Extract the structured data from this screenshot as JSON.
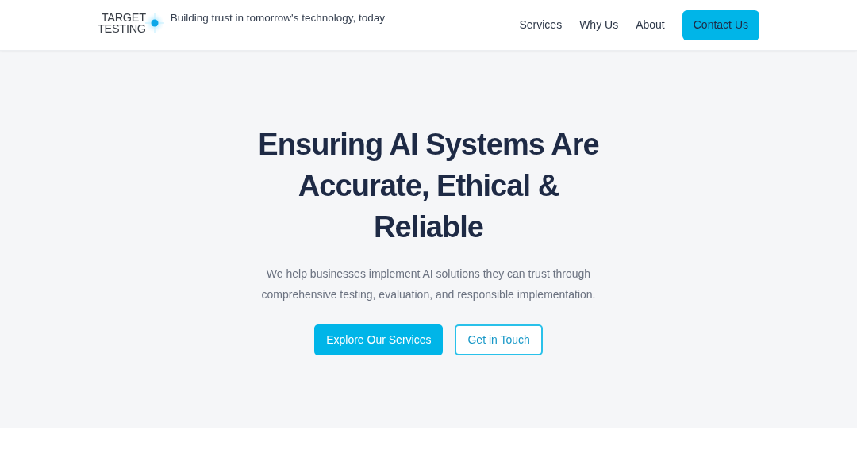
{
  "header": {
    "logo": {
      "line_1": "TARGET",
      "line_2": "TESTING"
    },
    "tagline": "Building trust in tomorrow's technology, today",
    "nav": [
      {
        "label": "Services",
        "kind": "link"
      },
      {
        "label": "Why Us",
        "kind": "link"
      },
      {
        "label": "About",
        "kind": "link"
      },
      {
        "label": "Contact Us",
        "kind": "button"
      }
    ]
  },
  "hero": {
    "title": "Ensuring AI Systems Are Accurate, Ethical & Reliable",
    "subtitle": "We help businesses implement AI solutions they can trust through comprehensive testing, evaluation, and responsible implementation.",
    "buttons": [
      {
        "label": "Explore Our Services",
        "kind": "primary"
      },
      {
        "label": "Get in Touch",
        "kind": "outline"
      }
    ]
  }
}
